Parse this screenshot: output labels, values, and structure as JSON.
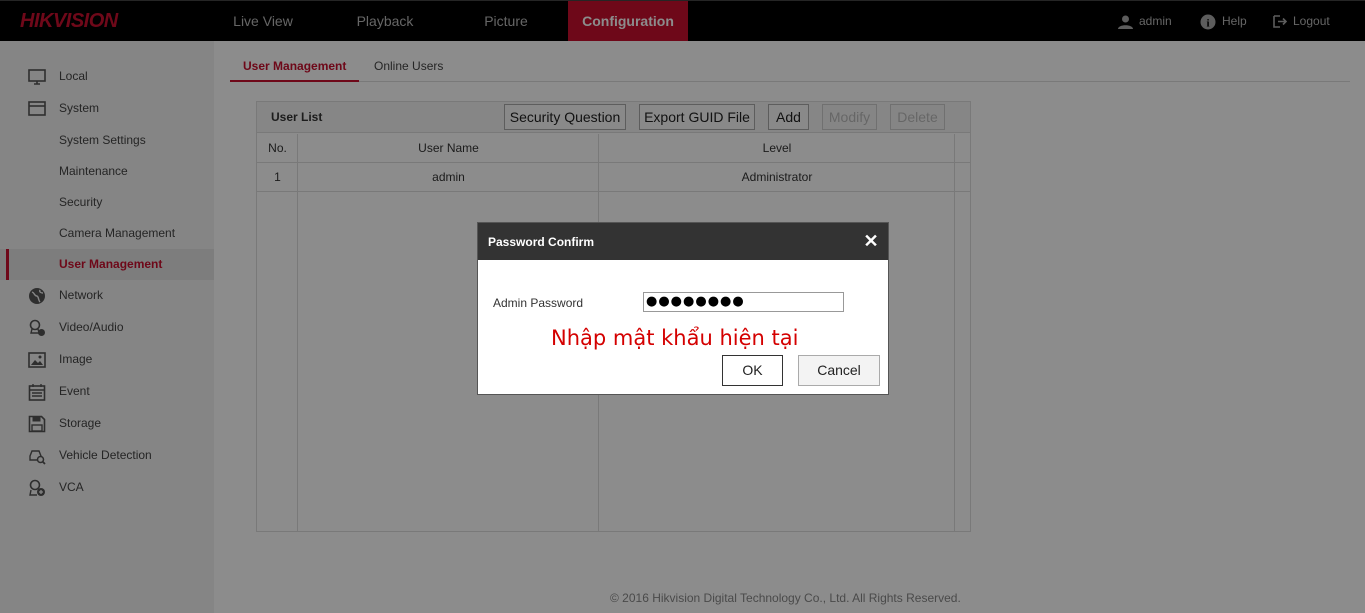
{
  "header": {
    "logo": "HIKVISION",
    "nav": [
      "Live View",
      "Playback",
      "Picture",
      "Configuration"
    ],
    "user": "admin",
    "help": "Help",
    "logout": "Logout"
  },
  "sidebar": {
    "items": [
      {
        "label": "Local",
        "icon": "monitor-icon"
      },
      {
        "label": "System",
        "icon": "window-icon"
      },
      {
        "label": "System Settings"
      },
      {
        "label": "Maintenance"
      },
      {
        "label": "Security"
      },
      {
        "label": "Camera Management"
      },
      {
        "label": "User Management"
      },
      {
        "label": "Network",
        "icon": "globe-icon"
      },
      {
        "label": "Video/Audio",
        "icon": "video-audio-icon"
      },
      {
        "label": "Image",
        "icon": "image-icon"
      },
      {
        "label": "Event",
        "icon": "calendar-icon"
      },
      {
        "label": "Storage",
        "icon": "floppy-disk-icon"
      },
      {
        "label": "Vehicle Detection",
        "icon": "vehicle-search-icon"
      },
      {
        "label": "VCA",
        "icon": "vca-icon"
      }
    ]
  },
  "tabs": [
    "User Management",
    "Online Users"
  ],
  "user_list": {
    "title": "User List",
    "buttons": {
      "security_question": "Security Question",
      "export_guid": "Export GUID File",
      "add": "Add",
      "modify": "Modify",
      "delete": "Delete"
    },
    "columns": [
      "No.",
      "User Name",
      "Level"
    ],
    "rows": [
      {
        "no": "1",
        "user_name": "admin",
        "level": "Administrator"
      }
    ]
  },
  "footer": "© 2016 Hikvision Digital Technology Co., Ltd. All Rights Reserved.",
  "dialog": {
    "title": "Password Confirm",
    "label": "Admin Password",
    "password_value": "●●●●●●●●",
    "hint": "Nhập mật khẩu hiện tại",
    "ok": "OK",
    "cancel": "Cancel"
  },
  "colors": {
    "accent": "#c8102e",
    "hint": "#d40000"
  }
}
